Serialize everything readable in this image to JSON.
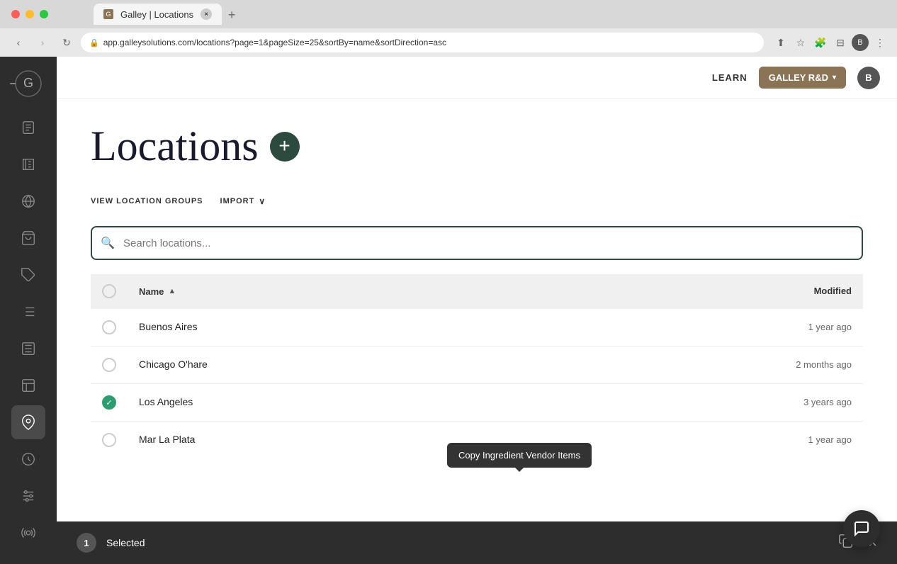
{
  "browser": {
    "tab_title": "Galley | Locations",
    "url": "app.galleysolutions.com/locations?page=1&pageSize=25&sortBy=name&sortDirection=asc",
    "new_tab_label": "+",
    "close_tab_label": "×"
  },
  "header": {
    "learn_label": "LEARN",
    "workspace_label": "GALLEY R&D",
    "avatar_label": "B"
  },
  "page": {
    "title": "Locations",
    "add_button_label": "+",
    "view_location_groups_label": "VIEW LOCATION GROUPS",
    "import_label": "IMPORT",
    "search_placeholder": "Search locations...",
    "table": {
      "col_name": "Name",
      "col_modified": "Modified",
      "rows": [
        {
          "id": 1,
          "name": "Buenos Aires",
          "modified": "1 year ago",
          "checked": false
        },
        {
          "id": 2,
          "name": "Chicago O'hare",
          "modified": "2 months ago",
          "checked": false
        },
        {
          "id": 3,
          "name": "Los Angeles",
          "modified": "3 years ago",
          "checked": true
        },
        {
          "id": 4,
          "name": "Mar La Plata",
          "modified": "1 year ago",
          "checked": false
        }
      ]
    }
  },
  "selection_bar": {
    "count": "1",
    "label": "Selected",
    "close_label": "×"
  },
  "tooltip": {
    "text": "Copy Ingredient Vendor Items"
  },
  "sidebar": {
    "items": [
      {
        "id": "logo",
        "icon": "G",
        "active": false
      },
      {
        "id": "ingredients",
        "icon": "📄",
        "active": false
      },
      {
        "id": "recipes",
        "icon": "📖",
        "active": false
      },
      {
        "id": "globe",
        "icon": "🌐",
        "active": false
      },
      {
        "id": "products",
        "icon": "🛍",
        "active": false
      },
      {
        "id": "tags",
        "icon": "🏷",
        "active": false
      },
      {
        "id": "orders",
        "icon": "📋",
        "active": false
      },
      {
        "id": "menus",
        "icon": "📰",
        "active": false
      },
      {
        "id": "reports",
        "icon": "📊",
        "active": false
      },
      {
        "id": "locations",
        "icon": "📍",
        "active": true
      },
      {
        "id": "dining",
        "icon": "🍽",
        "active": false
      },
      {
        "id": "settings",
        "icon": "⚙",
        "active": false
      },
      {
        "id": "analytics",
        "icon": "📡",
        "active": false
      }
    ]
  },
  "colors": {
    "sidebar_bg": "#2d2d2d",
    "active_sidebar": "#4a4a4a",
    "accent_green": "#2d4a3e",
    "checked_green": "#2d9e6e",
    "workspace_btn": "#8b7355"
  }
}
